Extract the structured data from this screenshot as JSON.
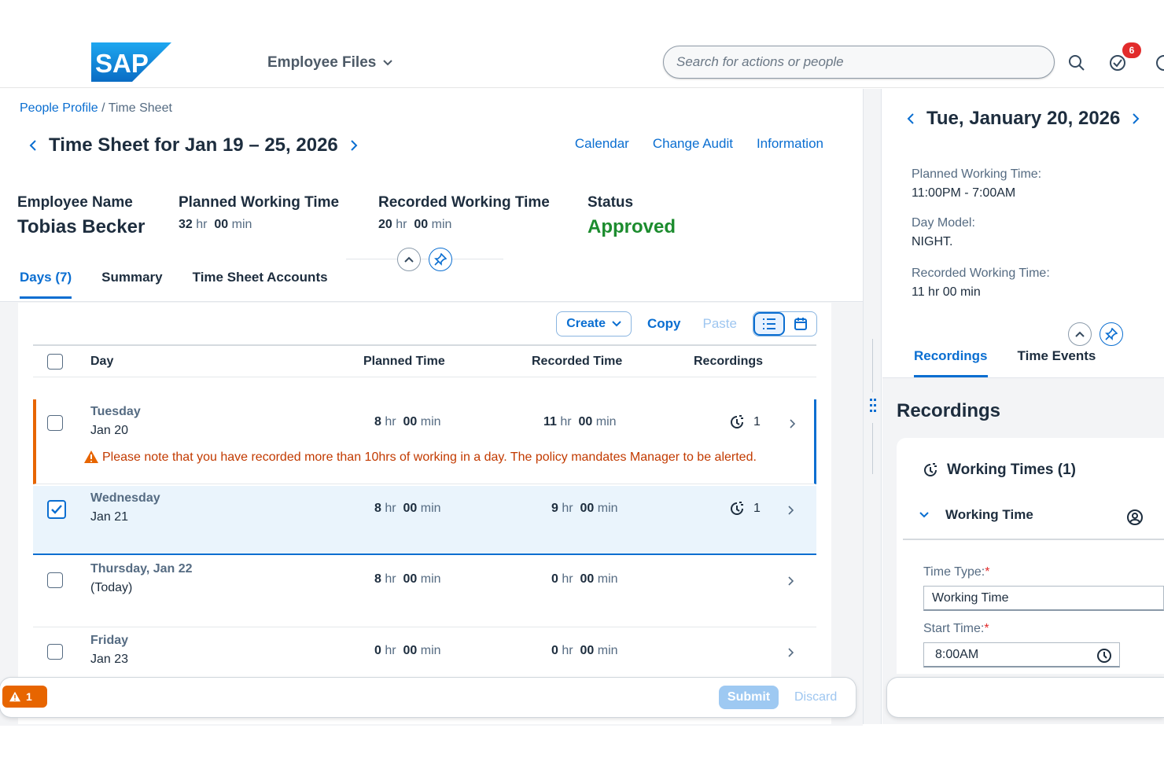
{
  "shell": {
    "logo_text": "SAP",
    "nav_menu_label": "Employee Files",
    "search_placeholder": "Search for actions or people",
    "notification_count": "6"
  },
  "breadcrumb": {
    "link": "People Profile",
    "separator": "/",
    "current": "Time Sheet"
  },
  "page": {
    "title": "Time Sheet for Jan 19 – 25, 2026",
    "links": [
      "Calendar",
      "Change Audit",
      "Information"
    ]
  },
  "kpis": {
    "employee_label": "Employee Name",
    "employee_name": "Tobias Becker",
    "planned_label": "Planned Working Time",
    "planned_hr": "32",
    "planned_min": "00",
    "recorded_label": "Recorded Working Time",
    "recorded_hr": "20",
    "recorded_min": "00",
    "status_label": "Status",
    "status_value": "Approved",
    "unit_hr": "hr",
    "unit_min": "min"
  },
  "tabs": [
    "Days (7)",
    "Summary",
    "Time Sheet Accounts"
  ],
  "toolbar": {
    "create": "Create",
    "copy": "Copy",
    "paste": "Paste"
  },
  "table": {
    "columns": [
      "Day",
      "Planned Time",
      "Recorded Time",
      "Recordings"
    ],
    "rows": [
      {
        "day": "Tuesday",
        "date": "Jan 20",
        "planned_hr": "8",
        "planned_min": "00",
        "recorded_hr": "11",
        "recorded_min": "00",
        "recordings": "1"
      },
      {
        "day": "Wednesday",
        "date": "Jan 21",
        "planned_hr": "8",
        "planned_min": "00",
        "recorded_hr": "9",
        "recorded_min": "00",
        "recordings": "1"
      },
      {
        "day": "Thursday, Jan 22",
        "date": "(Today)",
        "planned_hr": "8",
        "planned_min": "00",
        "recorded_hr": "0",
        "recorded_min": "00",
        "recordings": ""
      },
      {
        "day": "Friday",
        "date": "Jan 23",
        "planned_hr": "0",
        "planned_min": "00",
        "recorded_hr": "0",
        "recorded_min": "00",
        "recordings": ""
      }
    ],
    "warning": "Please note that you have recorded more than 10hrs of working in a day. The policy mandates Manager to be alerted."
  },
  "footer": {
    "message_count": "1",
    "submit": "Submit",
    "discard": "Discard"
  },
  "detail": {
    "title": "Tue, January 20, 2026",
    "planned_label": "Planned Working Time:",
    "planned_value": "11:00PM - 7:00AM",
    "day_model_label": "Day Model:",
    "day_model_value": "NIGHT.",
    "recorded_label": "Recorded Working Time:",
    "recorded_value": "11 hr 00 min",
    "tabs": [
      "Recordings",
      "Time Events"
    ],
    "section_title": "Recordings",
    "group_title": "Working Times (1)",
    "item_title": "Working Time",
    "time_type_label": "Time Type:",
    "time_type_value": "Working Time",
    "start_time_label": "Start Time:",
    "start_time_value": "8:00AM"
  },
  "colors": {
    "accent": "#0a6ed1",
    "warning": "#e76500",
    "success": "#1c8c2e",
    "badge": "#e22b2b"
  }
}
